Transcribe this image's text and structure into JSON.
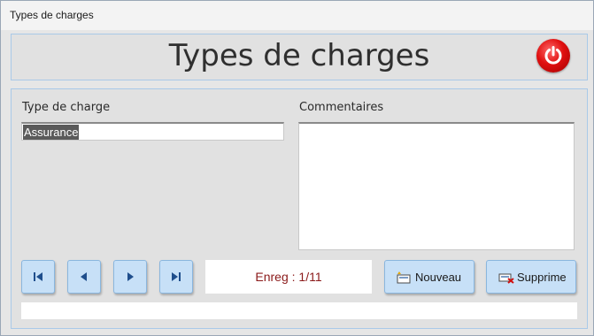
{
  "window": {
    "title": "Types de charges"
  },
  "header": {
    "heading": "Types de charges",
    "power_icon": "power-icon",
    "power_color": "#e01010"
  },
  "form": {
    "type_label": "Type de charge",
    "type_value": "Assurance",
    "comment_label": "Commentaires",
    "comment_value": ""
  },
  "nav": {
    "first_icon": "first-record-icon",
    "prev_icon": "previous-record-icon",
    "next_icon": "next-record-icon",
    "last_icon": "last-record-icon",
    "record_text": "Enreg : 1/11"
  },
  "actions": {
    "new_label": "Nouveau",
    "new_icon": "new-record-icon",
    "delete_label": "Supprime",
    "delete_icon": "delete-record-icon"
  },
  "colors": {
    "button_bg": "#c7e0f7",
    "counter_text": "#8b1a1a",
    "panel_border": "#a9c9e8"
  }
}
